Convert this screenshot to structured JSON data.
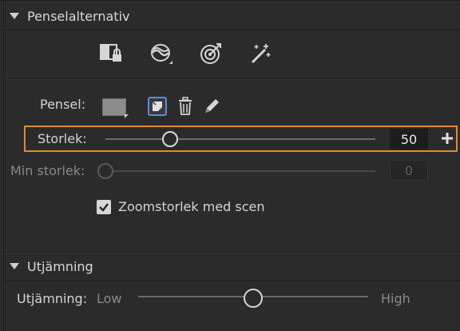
{
  "brush_options": {
    "header": "Penselalternativ",
    "tools": [
      {
        "icon": "lock-mask-icon"
      },
      {
        "icon": "blend-mode-icon"
      },
      {
        "icon": "target-icon"
      },
      {
        "icon": "magic-wand-icon"
      }
    ]
  },
  "brush": {
    "label": "Pensel:",
    "swatch_color": "#8c8c8c",
    "icons": [
      "brush-swatch-icon",
      "brush-shape-icon",
      "trash-icon",
      "pen-icon"
    ]
  },
  "size": {
    "label": "Storlek:",
    "value": "50",
    "slider_fraction": 0.24,
    "plus": "+"
  },
  "min_size": {
    "label": "Min storlek:",
    "value": "0",
    "slider_fraction": 0.0
  },
  "zoom_checkbox": {
    "checked": true,
    "label": "Zoomstorlek med scen"
  },
  "smoothing": {
    "header": "Utjämning",
    "label": "Utjämning:",
    "low": "Low",
    "high": "High",
    "slider_fraction": 0.5
  },
  "colors": {
    "highlight": "#e38a2a",
    "selection": "#5d8fd0"
  }
}
